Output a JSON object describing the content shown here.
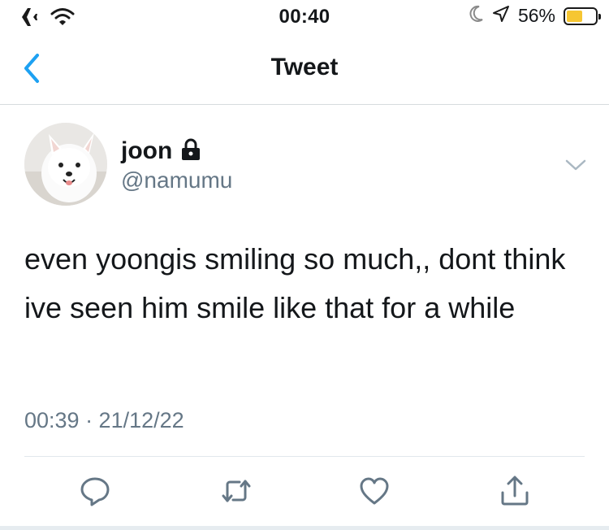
{
  "status_bar": {
    "time": "00:40",
    "battery_percent": "56%",
    "battery_level": 0.56,
    "icons": [
      "airplane-icon",
      "wifi-icon",
      "moon-icon",
      "location-arrow-icon",
      "battery-icon"
    ]
  },
  "nav": {
    "title": "Tweet",
    "back_icon": "chevron-left-icon"
  },
  "tweet": {
    "display_name": "joon",
    "handle": "@namumu",
    "protected_icon": "lock-icon",
    "text": "even yoongis smiling so much,, dont think ive seen him smile like that for a while",
    "timestamp": "00:39 · 21/12/22",
    "actions": [
      "reply-icon",
      "retweet-icon",
      "like-icon",
      "share-icon"
    ]
  },
  "colors": {
    "accent": "#1da1f2",
    "secondary_text": "#657786",
    "battery_fill": "#f6c632"
  }
}
